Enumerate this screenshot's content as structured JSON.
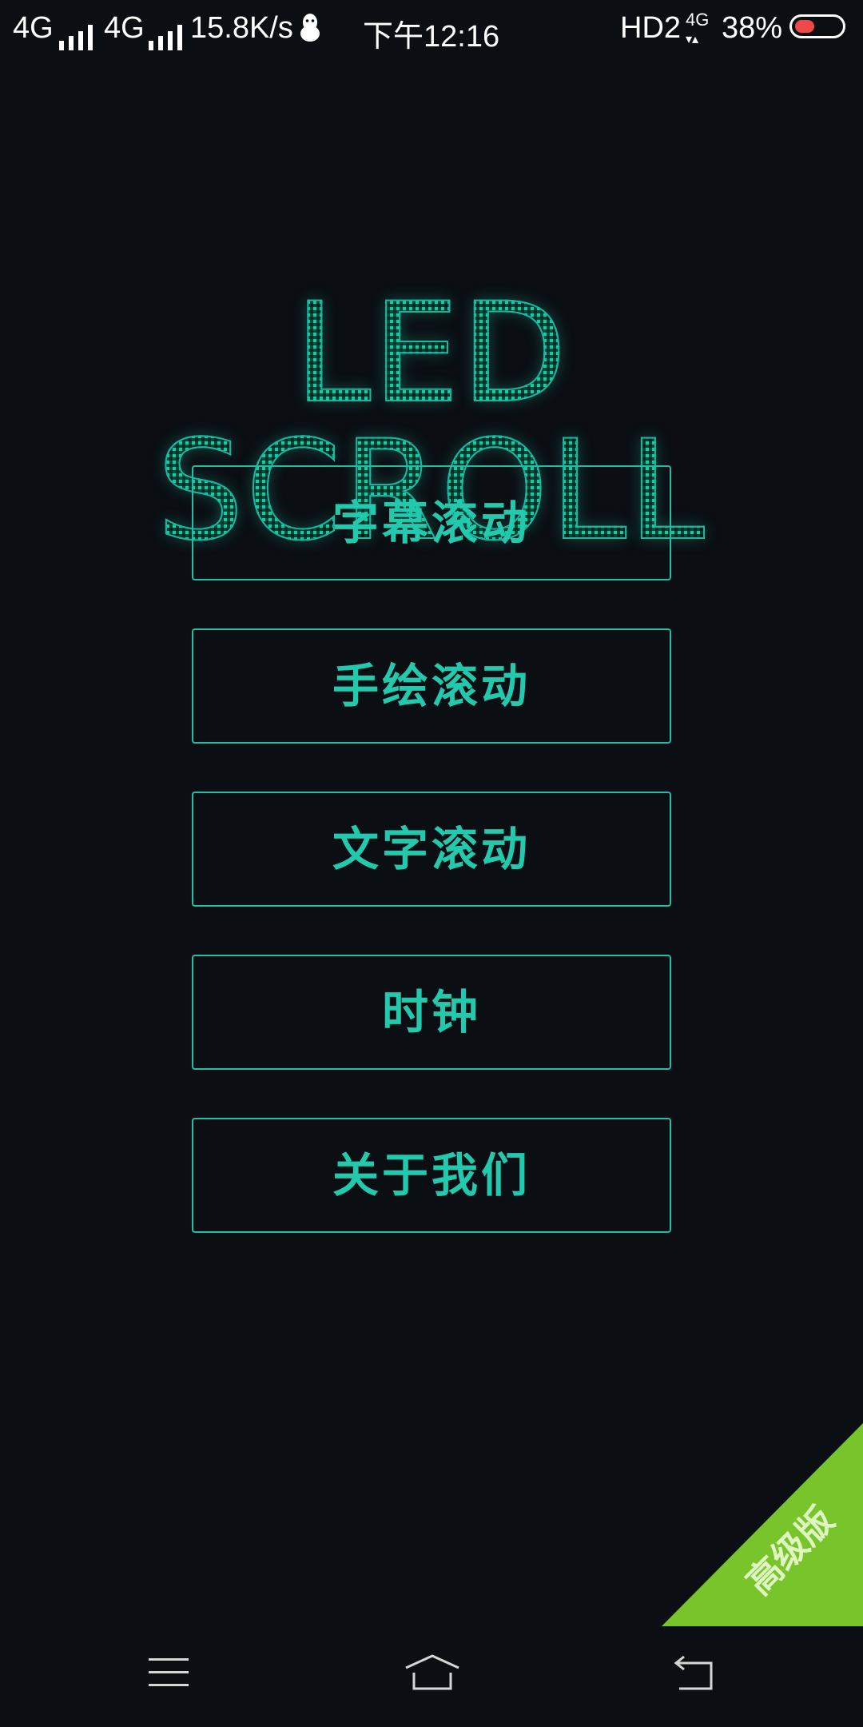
{
  "status_bar": {
    "network_1": "4G",
    "network_2": "4G",
    "speed": "15.8K/s",
    "time": "下午12:16",
    "hd": "HD2",
    "data_type": "4G",
    "battery": "38%"
  },
  "title": "LED SCROLL",
  "menu": [
    {
      "label": "字幕滚动"
    },
    {
      "label": "手绘滚动"
    },
    {
      "label": "文字滚动"
    },
    {
      "label": "时钟"
    },
    {
      "label": "关于我们"
    }
  ],
  "premium_badge": "高级版",
  "colors": {
    "background": "#0b0f14",
    "accent": "#22c9ad",
    "premium": "#77c52b"
  },
  "nav": {
    "menu_icon": "menu-icon",
    "home_icon": "home-icon",
    "back_icon": "back-icon"
  }
}
